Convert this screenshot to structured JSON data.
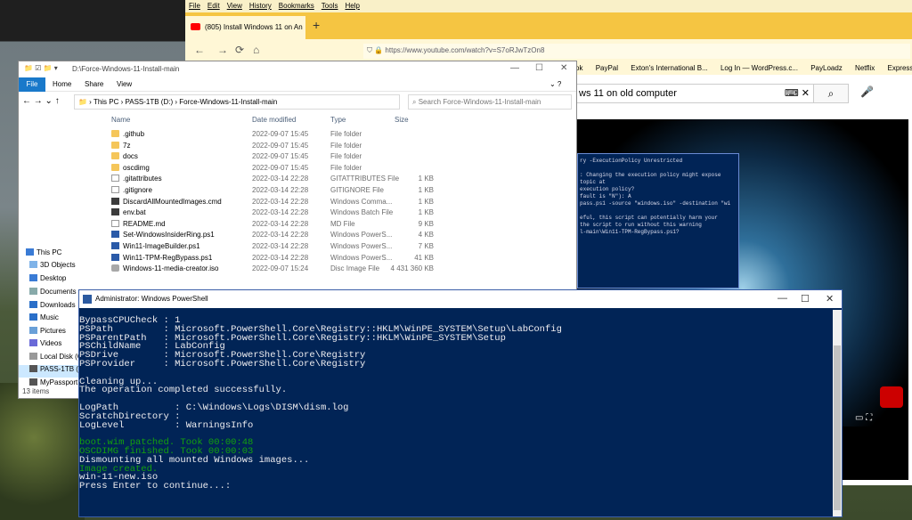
{
  "firefox": {
    "menu": [
      "File",
      "Edit",
      "View",
      "History",
      "Bookmarks",
      "Tools",
      "Help"
    ],
    "tab_title": "(805) Install Windows 11 on An",
    "new_tab": "+",
    "url": "https://www.youtube.com/watch?v=S7oRJwTzOn8",
    "bookmarks": [
      "ok",
      "PayPal",
      "Exton's International B...",
      "Log In — WordPress.c...",
      "PayLoadz",
      "Netflix",
      "Express"
    ],
    "youtube_search_value": "ws 11 on old computer"
  },
  "ps_small": {
    "lines": [
      "ry -ExecutionPolicy Unrestricted",
      "",
      ": Changing the execution policy might expose",
      "topic at",
      "execution policy?",
      "fault is \"N\"): A",
      "pass.ps1 -source \"windows.iso\" -destination \"wi",
      "",
      "eful, this script can potentially harm your",
      "the script to run without this warning",
      "l-main\\Win11-TPM-RegBypass.ps1?"
    ]
  },
  "explorer": {
    "title": "D:\\Force-Windows-11-Install-main",
    "ribbon": [
      "File",
      "Home",
      "Share",
      "View"
    ],
    "breadcrumb": [
      "This PC",
      "PASS-1TB (D:)",
      "Force-Windows-11-Install-main"
    ],
    "search_placeholder": "Search Force-Windows-11-Install-main",
    "columns": [
      "Name",
      "Date modified",
      "Type",
      "Size"
    ],
    "nav": [
      "This PC",
      "3D Objects",
      "Desktop",
      "Documents",
      "Downloads",
      "Music",
      "Pictures",
      "Videos",
      "Local Disk (C",
      "PASS-1TB (D:",
      "MyPassport"
    ],
    "files": [
      {
        "name": ".github",
        "date": "2022-09-07 15:45",
        "type": "File folder",
        "size": "",
        "icon": "folder"
      },
      {
        "name": "7z",
        "date": "2022-09-07 15:45",
        "type": "File folder",
        "size": "",
        "icon": "folder"
      },
      {
        "name": "docs",
        "date": "2022-09-07 15:45",
        "type": "File folder",
        "size": "",
        "icon": "folder"
      },
      {
        "name": "oscdimg",
        "date": "2022-09-07 15:45",
        "type": "File folder",
        "size": "",
        "icon": "folder"
      },
      {
        "name": ".gitattributes",
        "date": "2022-03-14 22:28",
        "type": "GITATTRIBUTES File",
        "size": "1 KB",
        "icon": "file"
      },
      {
        "name": ".gitignore",
        "date": "2022-03-14 22:28",
        "type": "GITIGNORE File",
        "size": "1 KB",
        "icon": "file"
      },
      {
        "name": "DiscardAllMountedImages.cmd",
        "date": "2022-03-14 22:28",
        "type": "Windows Comma...",
        "size": "1 KB",
        "icon": "cmd"
      },
      {
        "name": "env.bat",
        "date": "2022-03-14 22:28",
        "type": "Windows Batch File",
        "size": "1 KB",
        "icon": "cmd"
      },
      {
        "name": "README.md",
        "date": "2022-03-14 22:28",
        "type": "MD File",
        "size": "9 KB",
        "icon": "file"
      },
      {
        "name": "Set-WindowsInsiderRing.ps1",
        "date": "2022-03-14 22:28",
        "type": "Windows PowerS...",
        "size": "4 KB",
        "icon": "script"
      },
      {
        "name": "Win11-ImageBuilder.ps1",
        "date": "2022-03-14 22:28",
        "type": "Windows PowerS...",
        "size": "7 KB",
        "icon": "script"
      },
      {
        "name": "Win11-TPM-RegBypass.ps1",
        "date": "2022-03-14 22:28",
        "type": "Windows PowerS...",
        "size": "41 KB",
        "icon": "script"
      },
      {
        "name": "Windows-11-media-creator.iso",
        "date": "2022-09-07 15:24",
        "type": "Disc Image File",
        "size": "4 431 360 KB",
        "icon": "disc"
      }
    ],
    "status": "13 items"
  },
  "powershell": {
    "title": "Administrator: Windows PowerShell",
    "lines": [
      {
        "text": "BypassCPUCheck : 1",
        "color": "white"
      },
      {
        "text": "PSPath         : Microsoft.PowerShell.Core\\Registry::HKLM\\WinPE_SYSTEM\\Setup\\LabConfig",
        "color": "white"
      },
      {
        "text": "PSParentPath   : Microsoft.PowerShell.Core\\Registry::HKLM\\WinPE_SYSTEM\\Setup",
        "color": "white"
      },
      {
        "text": "PSChildName    : LabConfig",
        "color": "white"
      },
      {
        "text": "PSDrive        : Microsoft.PowerShell.Core\\Registry",
        "color": "white"
      },
      {
        "text": "PSProvider     : Microsoft.PowerShell.Core\\Registry",
        "color": "white"
      },
      {
        "text": "",
        "color": "white"
      },
      {
        "text": "Cleaning up...",
        "color": "white"
      },
      {
        "text": "The operation completed successfully.",
        "color": "white"
      },
      {
        "text": "",
        "color": "white"
      },
      {
        "text": "LogPath          : C:\\Windows\\Logs\\DISM\\dism.log",
        "color": "white"
      },
      {
        "text": "ScratchDirectory :",
        "color": "white"
      },
      {
        "text": "LogLevel         : WarningsInfo",
        "color": "white"
      },
      {
        "text": "",
        "color": "white"
      },
      {
        "text": "boot.wim patched. Took 00:00:48",
        "color": "green"
      },
      {
        "text": "OSCDIMG finished. Took 00:00:03",
        "color": "green"
      },
      {
        "text": "Dismounting all mounted Windows images...",
        "color": "white"
      },
      {
        "text": "Image created.",
        "color": "green"
      },
      {
        "text": "win-11-new.iso",
        "color": "white"
      },
      {
        "text": "Press Enter to continue...:",
        "color": "white"
      }
    ]
  },
  "colors": {
    "ps_background": "#012456",
    "ps_green": "#13a10e",
    "firefox_accent": "#f5c542",
    "explorer_accent": "#1979ca"
  }
}
